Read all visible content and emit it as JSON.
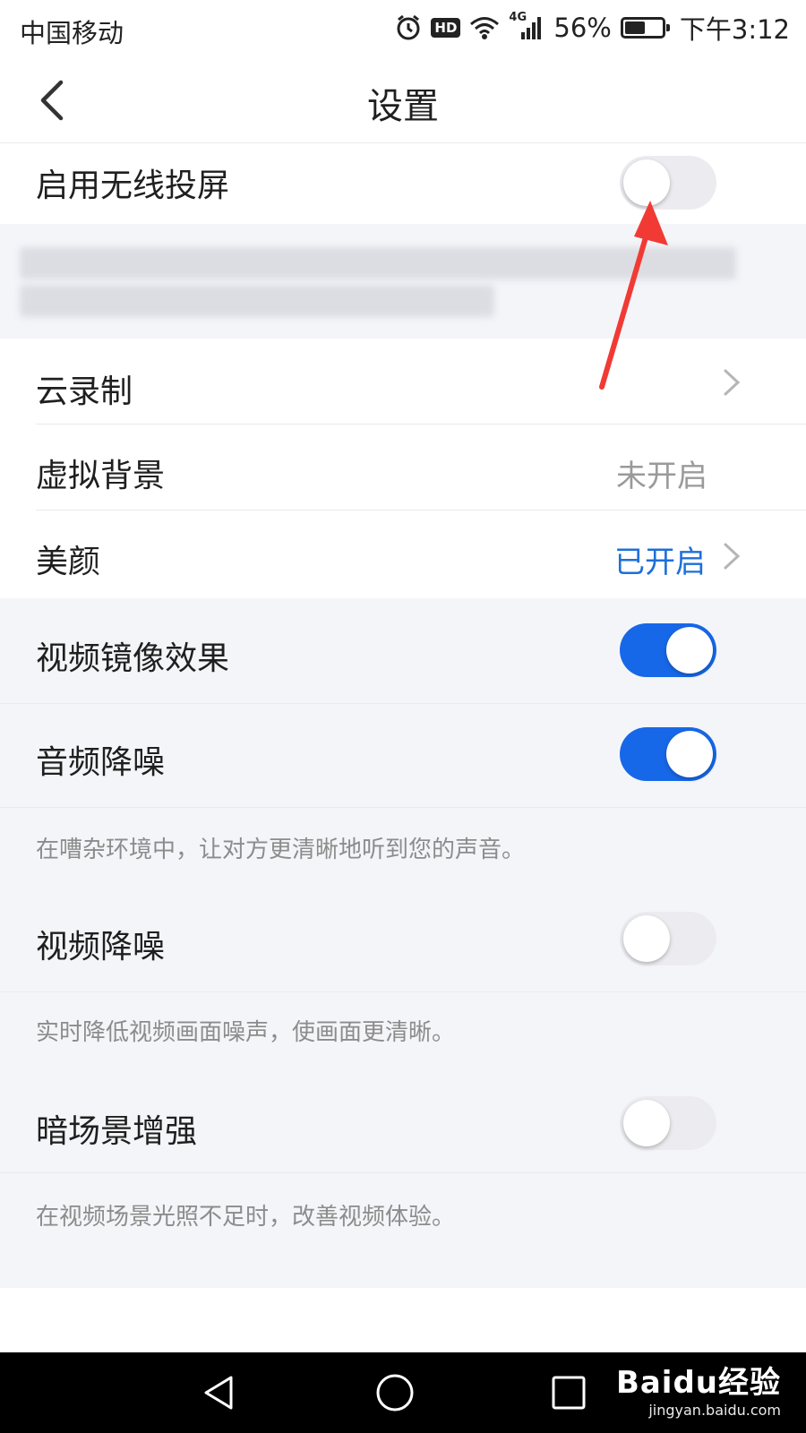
{
  "status_bar": {
    "carrier": "中国移动",
    "network": "4G",
    "battery_percent": "56%",
    "battery_level": 0.56,
    "time": "下午3:12",
    "hd_badge": "HD"
  },
  "header": {
    "title": "设置"
  },
  "settings": {
    "wireless_cast": {
      "label": "启用无线投屏",
      "enabled": false
    },
    "cloud_record": {
      "label": "云录制"
    },
    "virtual_bg": {
      "label": "虚拟背景",
      "value": "未开启"
    },
    "beauty": {
      "label": "美颜",
      "value": "已开启"
    },
    "video_mirror": {
      "label": "视频镜像效果",
      "enabled": true
    },
    "audio_noise": {
      "label": "音频降噪",
      "enabled": true,
      "hint": "在嘈杂环境中，让对方更清晰地听到您的声音。"
    },
    "video_noise": {
      "label": "视频降噪",
      "enabled": false,
      "hint": "实时降低视频画面噪声，使画面更清晰。"
    },
    "low_light": {
      "label": "暗场景增强",
      "enabled": false,
      "hint": "在视频场景光照不足时，改善视频体验。"
    }
  },
  "watermark": {
    "brand": "Baidu经验",
    "site": "jingyan.baidu.com"
  },
  "colors": {
    "accent": "#1768e8",
    "value_on": "#1e6fd9",
    "annotation_arrow": "#f23a35"
  }
}
